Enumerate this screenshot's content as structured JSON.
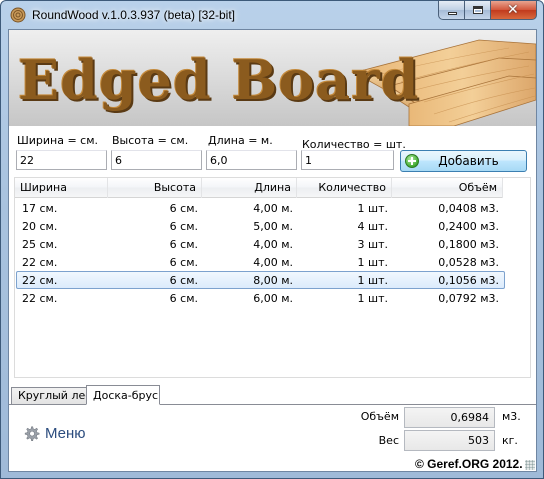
{
  "window": {
    "title": "RoundWood v.1.0.3.937 (beta) [32-bit]"
  },
  "banner": {
    "title": "Edged Board"
  },
  "inputs": {
    "width": {
      "label": "Ширина = см.",
      "value": "22"
    },
    "height": {
      "label": "Высота = см.",
      "value": "6"
    },
    "length": {
      "label": "Длина = м.",
      "value": "6,0"
    },
    "quantity": {
      "label": "Количество = шт.",
      "value": "1"
    }
  },
  "add_button": {
    "label": "Добавить",
    "icon": "add-plus-icon"
  },
  "table": {
    "columns": [
      "Ширина",
      "Высота",
      "Длина",
      "Количество",
      "Объём"
    ],
    "rows": [
      [
        "17 см.",
        "6 см.",
        "4,00 м.",
        "1 шт.",
        "0,0408 м3."
      ],
      [
        "20 см.",
        "6 см.",
        "5,00 м.",
        "4 шт.",
        "0,2400 м3."
      ],
      [
        "25 см.",
        "6 см.",
        "4,00 м.",
        "3 шт.",
        "0,1800 м3."
      ],
      [
        "22 см.",
        "6 см.",
        "4,00 м.",
        "1 шт.",
        "0,0528 м3."
      ],
      [
        "22 см.",
        "6 см.",
        "8,00 м.",
        "1 шт.",
        "0,1056 м3."
      ],
      [
        "22 см.",
        "6 см.",
        "6,00 м.",
        "1 шт.",
        "0,0792 м3."
      ]
    ],
    "selected_row": 4
  },
  "tabs": [
    {
      "label": "Круглый лес",
      "active": false
    },
    {
      "label": "Доска-брус",
      "active": true
    }
  ],
  "menu": {
    "label": "Меню",
    "icon": "gear-icon"
  },
  "summary": {
    "volume": {
      "label": "Объём",
      "value": "0,6984",
      "unit": "м3."
    },
    "weight": {
      "label": "Вес",
      "value": "503",
      "unit": "кг."
    }
  },
  "copyright": "© Geref.ORG 2012.",
  "colors": {
    "accent_blue": "#3c7fb1",
    "selection": "#dcebfc",
    "banner_brown": "#8b5b1e",
    "close_red": "#c13a1d"
  }
}
